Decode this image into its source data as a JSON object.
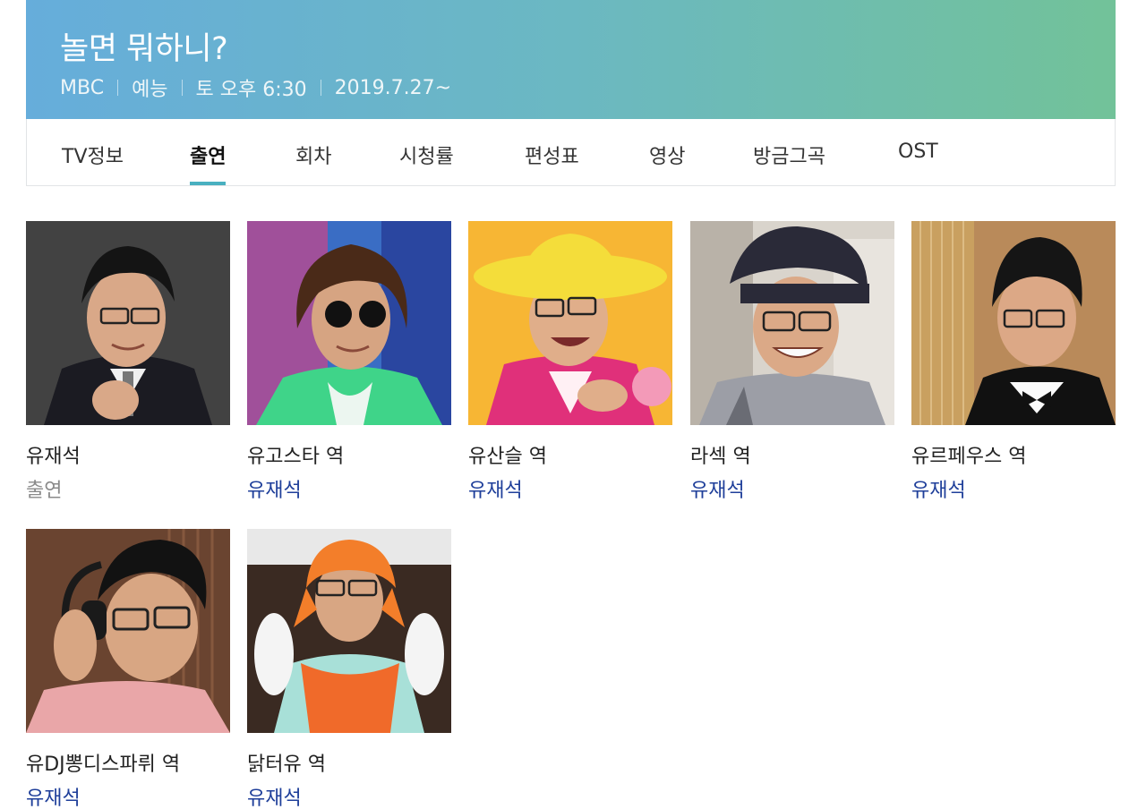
{
  "header": {
    "title": "놀면 뭐하니?",
    "meta": [
      "MBC",
      "예능",
      "토 오후 6:30",
      "2019.7.27~"
    ],
    "gradient": [
      "#66addb",
      "#72c299"
    ]
  },
  "tabs": [
    {
      "label": "TV정보",
      "active": false
    },
    {
      "label": "출연",
      "active": true
    },
    {
      "label": "회차",
      "active": false
    },
    {
      "label": "시청률",
      "active": false
    },
    {
      "label": "편성표",
      "active": false
    },
    {
      "label": "영상",
      "active": false
    },
    {
      "label": "방금그곡",
      "active": false
    },
    {
      "label": "OST",
      "active": false
    }
  ],
  "cast": [
    {
      "role": "유재석",
      "actor": "출연",
      "actor_link": false
    },
    {
      "role": "유고스타 역",
      "actor": "유재석",
      "actor_link": true
    },
    {
      "role": "유산슬 역",
      "actor": "유재석",
      "actor_link": true
    },
    {
      "role": "라섹 역",
      "actor": "유재석",
      "actor_link": true
    },
    {
      "role": "유르페우스 역",
      "actor": "유재석",
      "actor_link": true
    },
    {
      "role": "유DJ뽕디스파뤼 역",
      "actor": "유재석",
      "actor_link": true
    },
    {
      "role": "닭터유 역",
      "actor": "유재석",
      "actor_link": true
    }
  ],
  "colors": {
    "accent_underline": "#49b0c0",
    "actor_link": "#1f3f9a"
  }
}
